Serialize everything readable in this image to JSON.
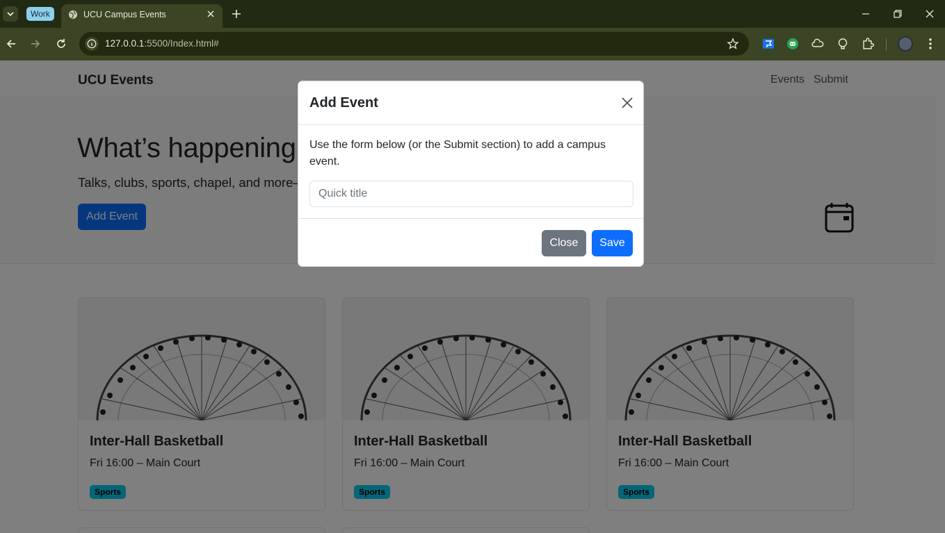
{
  "browser": {
    "tab_group_label": "Work",
    "tab_title": "UCU Campus Events",
    "url_host": "127.0.0.1",
    "url_rest": ":5500/Index.html#"
  },
  "site": {
    "brand": "UCU Events",
    "nav": [
      "Events",
      "Submit"
    ]
  },
  "hero": {
    "title": "What’s happening on campus",
    "lead": "Talks, clubs, sports, chapel, and more—",
    "button_label": "Add Event"
  },
  "cards": [
    {
      "title": "Inter-Hall Basketball",
      "meta": "Fri 16:00 – Main Court",
      "badge": "Sports"
    },
    {
      "title": "Inter-Hall Basketball",
      "meta": "Fri 16:00 – Main Court",
      "badge": "Sports"
    },
    {
      "title": "Inter-Hall Basketball",
      "meta": "Fri 16:00 – Main Court",
      "badge": "Sports"
    }
  ],
  "modal": {
    "title": "Add Event",
    "body_text": "Use the form below (or the Submit section) to add a campus event.",
    "input_placeholder": "Quick title",
    "close_label": "Close",
    "save_label": "Save"
  },
  "colors": {
    "primary": "#0d6efd",
    "secondary": "#6c757d",
    "badge": "#0dcaf0",
    "chrome_dark": "#212a12",
    "chrome_toolbar": "#3b4424"
  }
}
